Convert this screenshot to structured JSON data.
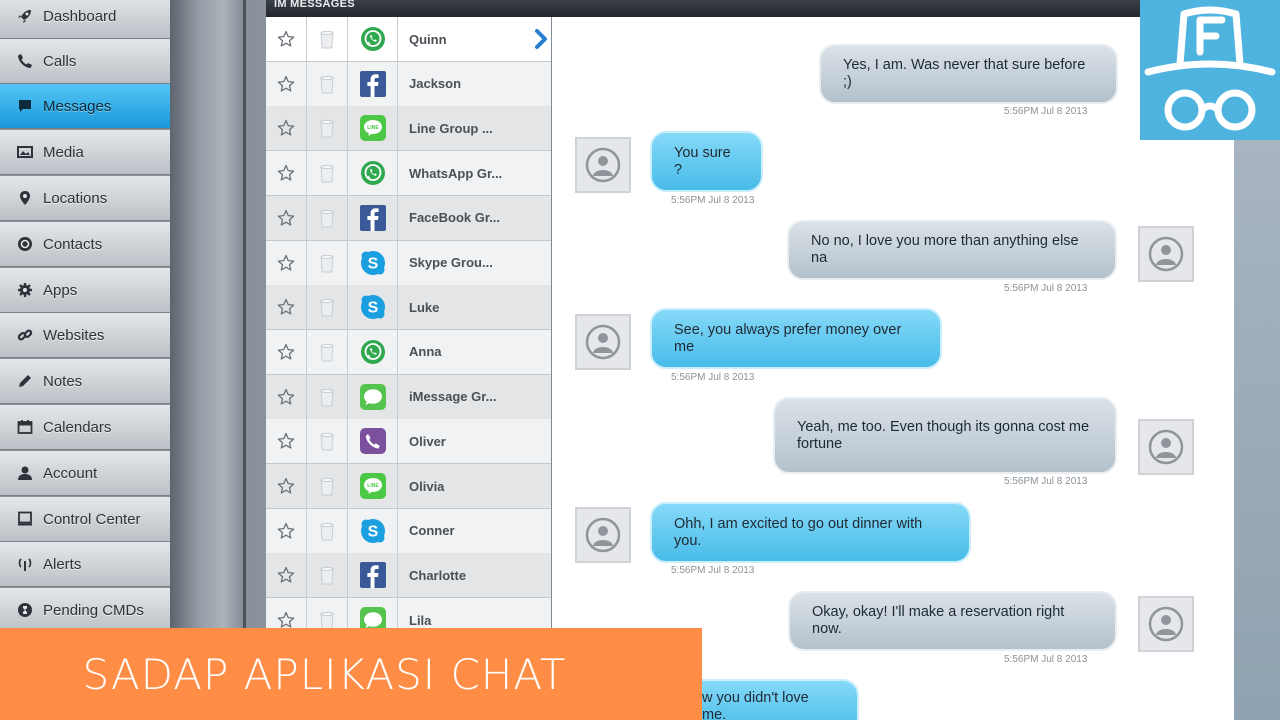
{
  "sidebar": {
    "items": [
      {
        "label": "Dashboard",
        "icon": "rocket-icon",
        "active": false
      },
      {
        "label": "Calls",
        "icon": "phone-icon",
        "active": false
      },
      {
        "label": "Messages",
        "icon": "message-icon",
        "active": true
      },
      {
        "label": "Media",
        "icon": "media-icon",
        "active": false
      },
      {
        "label": "Locations",
        "icon": "location-pin-icon",
        "active": false
      },
      {
        "label": "Contacts",
        "icon": "contacts-icon",
        "active": false
      },
      {
        "label": "Apps",
        "icon": "gear-icon",
        "active": false
      },
      {
        "label": "Websites",
        "icon": "link-icon",
        "active": false
      },
      {
        "label": "Notes",
        "icon": "pencil-icon",
        "active": false
      },
      {
        "label": "Calendars",
        "icon": "calendar-icon",
        "active": false
      },
      {
        "label": "Account",
        "icon": "user-icon",
        "active": false
      },
      {
        "label": "Control Center",
        "icon": "monitor-icon",
        "active": false
      },
      {
        "label": "Alerts",
        "icon": "signal-icon",
        "active": false
      },
      {
        "label": "Pending CMDs",
        "icon": "pending-icon",
        "active": false
      }
    ]
  },
  "panel": {
    "title": "IM MESSAGES"
  },
  "conversations": [
    {
      "name": "Quinn",
      "app": "whatsapp"
    },
    {
      "name": "Jackson",
      "app": "facebook"
    },
    {
      "name": "Line Group ...",
      "app": "line"
    },
    {
      "name": "WhatsApp Gr...",
      "app": "whatsapp"
    },
    {
      "name": "FaceBook Gr...",
      "app": "facebook"
    },
    {
      "name": "Skype Grou...",
      "app": "skype"
    },
    {
      "name": "Luke",
      "app": "skype"
    },
    {
      "name": "Anna",
      "app": "whatsapp"
    },
    {
      "name": "iMessage Gr...",
      "app": "imessage"
    },
    {
      "name": "Oliver",
      "app": "viber"
    },
    {
      "name": "Olivia",
      "app": "line"
    },
    {
      "name": "Conner",
      "app": "skype"
    },
    {
      "name": "Charlotte",
      "app": "facebook"
    },
    {
      "name": "Lila",
      "app": "imessage"
    }
  ],
  "messages": [
    {
      "dir": "out",
      "text": "Yes, I am. Was never that sure before ;)",
      "time": "5:56PM Jul 8 2013"
    },
    {
      "dir": "in",
      "text": "You sure ?",
      "time": "5:56PM Jul 8 2013"
    },
    {
      "dir": "out",
      "text": "No no, I love you more than anything else na",
      "time": "5:56PM Jul 8 2013"
    },
    {
      "dir": "in",
      "text": "See, you always prefer money over me",
      "time": "5:56PM Jul 8 2013"
    },
    {
      "dir": "out",
      "text": "Yeah, me too. Even though its gonna cost me fortune",
      "time": "5:56PM Jul 8 2013"
    },
    {
      "dir": "in",
      "text": "Ohh, I am excited to go out dinner with you.",
      "time": "5:56PM Jul 8 2013"
    },
    {
      "dir": "out",
      "text": "Okay, okay! I'll make a reservation right now.",
      "time": "5:56PM Jul 8 2013"
    },
    {
      "dir": "in",
      "text": "w you didn't love me.",
      "time": ""
    }
  ],
  "banner": {
    "text": "SADAP APLIKASI CHAT"
  },
  "colors": {
    "active_nav": "#1a98d9",
    "incoming_bubble": "#48bce9",
    "outgoing_bubble": "#b4c1cb",
    "banner": "#ff8d45",
    "brand_box": "#4fb3e0"
  }
}
